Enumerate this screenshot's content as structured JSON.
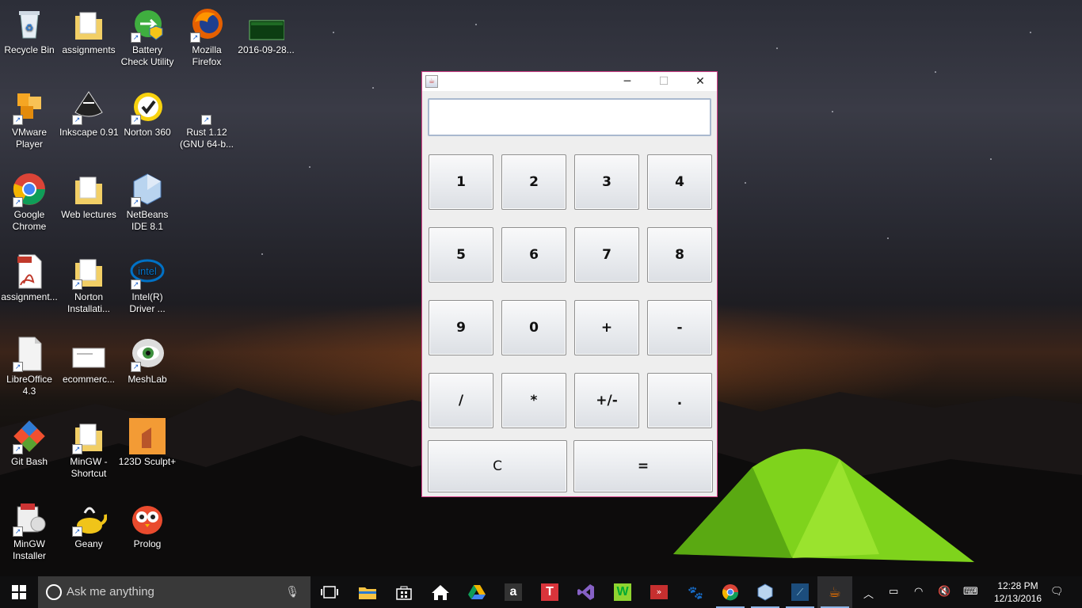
{
  "desktop": {
    "icons": [
      {
        "label": "Recycle Bin",
        "glyph": "recycle-bin-icon"
      },
      {
        "label": "assignments",
        "glyph": "folder-icon"
      },
      {
        "label": "Battery Check Utility",
        "glyph": "battery-utility-icon"
      },
      {
        "label": "Mozilla Firefox",
        "glyph": "firefox-icon"
      },
      {
        "label": "2016-09-28...",
        "glyph": "image-file-icon"
      },
      {
        "label": "VMware Player",
        "glyph": "vmware-icon"
      },
      {
        "label": "Inkscape 0.91",
        "glyph": "inkscape-icon"
      },
      {
        "label": "Norton 360",
        "glyph": "norton-icon"
      },
      {
        "label": "Rust 1.12 (GNU 64-b...",
        "glyph": "rust-icon"
      },
      {
        "label": "Google Chrome",
        "glyph": "chrome-icon"
      },
      {
        "label": "Web lectures",
        "glyph": "folder-icon"
      },
      {
        "label": "NetBeans IDE 8.1",
        "glyph": "netbeans-icon"
      },
      {
        "label": "assignment...",
        "glyph": "pdf-icon"
      },
      {
        "label": "Norton Installati...",
        "glyph": "folder-icon"
      },
      {
        "label": "Intel(R) Driver ...",
        "glyph": "intel-icon"
      },
      {
        "label": "LibreOffice 4.3",
        "glyph": "libreoffice-icon"
      },
      {
        "label": "ecommerc...",
        "glyph": "document-icon"
      },
      {
        "label": "MeshLab",
        "glyph": "meshlab-icon"
      },
      {
        "label": "Git Bash",
        "glyph": "git-icon"
      },
      {
        "label": "MinGW - Shortcut",
        "glyph": "folder-icon"
      },
      {
        "label": "123D Sculpt+",
        "glyph": "sculpt-icon"
      },
      {
        "label": "MinGW Installer",
        "glyph": "installer-icon"
      },
      {
        "label": "Geany",
        "glyph": "geany-icon"
      },
      {
        "label": "Prolog",
        "glyph": "prolog-icon"
      }
    ]
  },
  "calculator": {
    "window_buttons": {
      "minimize": "─",
      "maximize": "☐",
      "close": "✕"
    },
    "display_value": "",
    "keys": [
      "1",
      "2",
      "3",
      "4",
      "5",
      "6",
      "7",
      "8",
      "9",
      "0",
      "+",
      "-",
      "/",
      "*",
      "+/-",
      "."
    ],
    "clear_label": "C",
    "equals_label": "="
  },
  "taskbar": {
    "search_placeholder": "Ask me anything",
    "time": "12:28 PM",
    "date": "12/13/2016"
  }
}
